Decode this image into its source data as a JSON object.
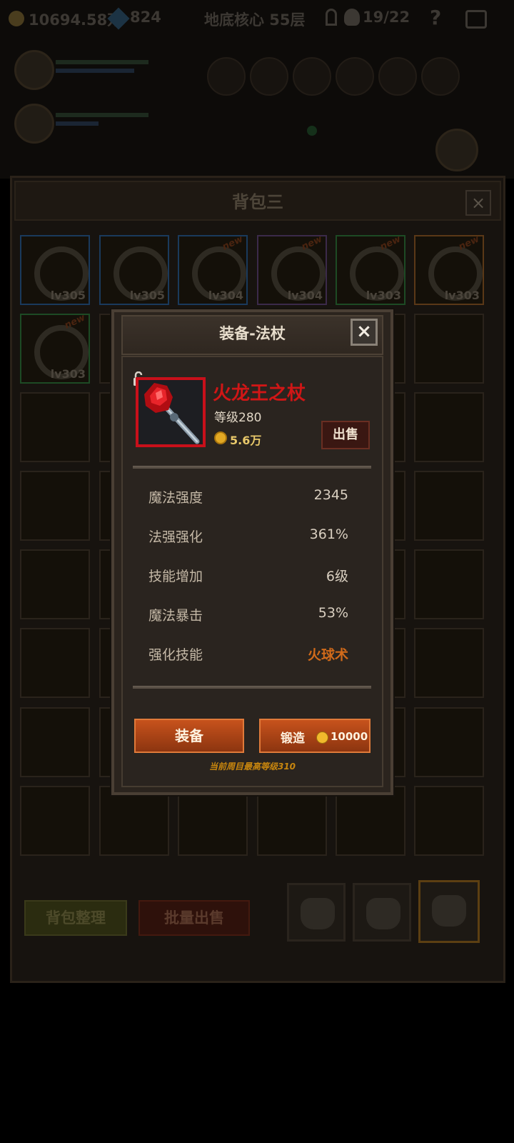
{
  "hud": {
    "gold": "10694.58万",
    "gems": "824",
    "stage": "地底核心 55层",
    "counter": "19/22",
    "help": "?"
  },
  "bag": {
    "title": "背包三",
    "close": "×",
    "items": [
      {
        "level": "lv305",
        "rarity": "blue",
        "icon": "ring-icon",
        "new": ""
      },
      {
        "level": "lv305",
        "rarity": "blue",
        "icon": "helmet-icon",
        "new": ""
      },
      {
        "level": "lv304",
        "rarity": "blue",
        "icon": "orb-icon",
        "new": "new"
      },
      {
        "level": "lv304",
        "rarity": "purple",
        "icon": "armor-icon",
        "new": "new"
      },
      {
        "level": "lv303",
        "rarity": "green",
        "icon": "ring-icon",
        "new": "new"
      },
      {
        "level": "lv303",
        "rarity": "orange",
        "icon": "feather-icon",
        "new": "new"
      },
      {
        "level": "lv303",
        "rarity": "green",
        "icon": "bow-icon",
        "new": "new"
      }
    ],
    "sort_button": "背包整理",
    "bulk_sell_button": "批量出售"
  },
  "modal": {
    "title": "装备-法杖",
    "close": "×",
    "item_name": "火龙王之杖",
    "item_level": "等级280",
    "price": "5.6万",
    "sell_button": "出售",
    "stats": [
      {
        "label": "魔法强度",
        "value": "2345"
      },
      {
        "label": "法强强化",
        "value": "361%"
      },
      {
        "label": "技能增加",
        "value": "6级"
      },
      {
        "label": "魔法暴击",
        "value": "53%"
      },
      {
        "label": "强化技能",
        "value": "火球术"
      }
    ],
    "equip_button": "装备",
    "forge_label": "锻造",
    "forge_cost": "10000",
    "max_level_note": "当前周目最高等级310"
  },
  "colors": {
    "item_name": "#d01616",
    "accent_skill": "#d16a1a",
    "button_orange": "#c7521c",
    "rarity_red": "#c8101a"
  }
}
